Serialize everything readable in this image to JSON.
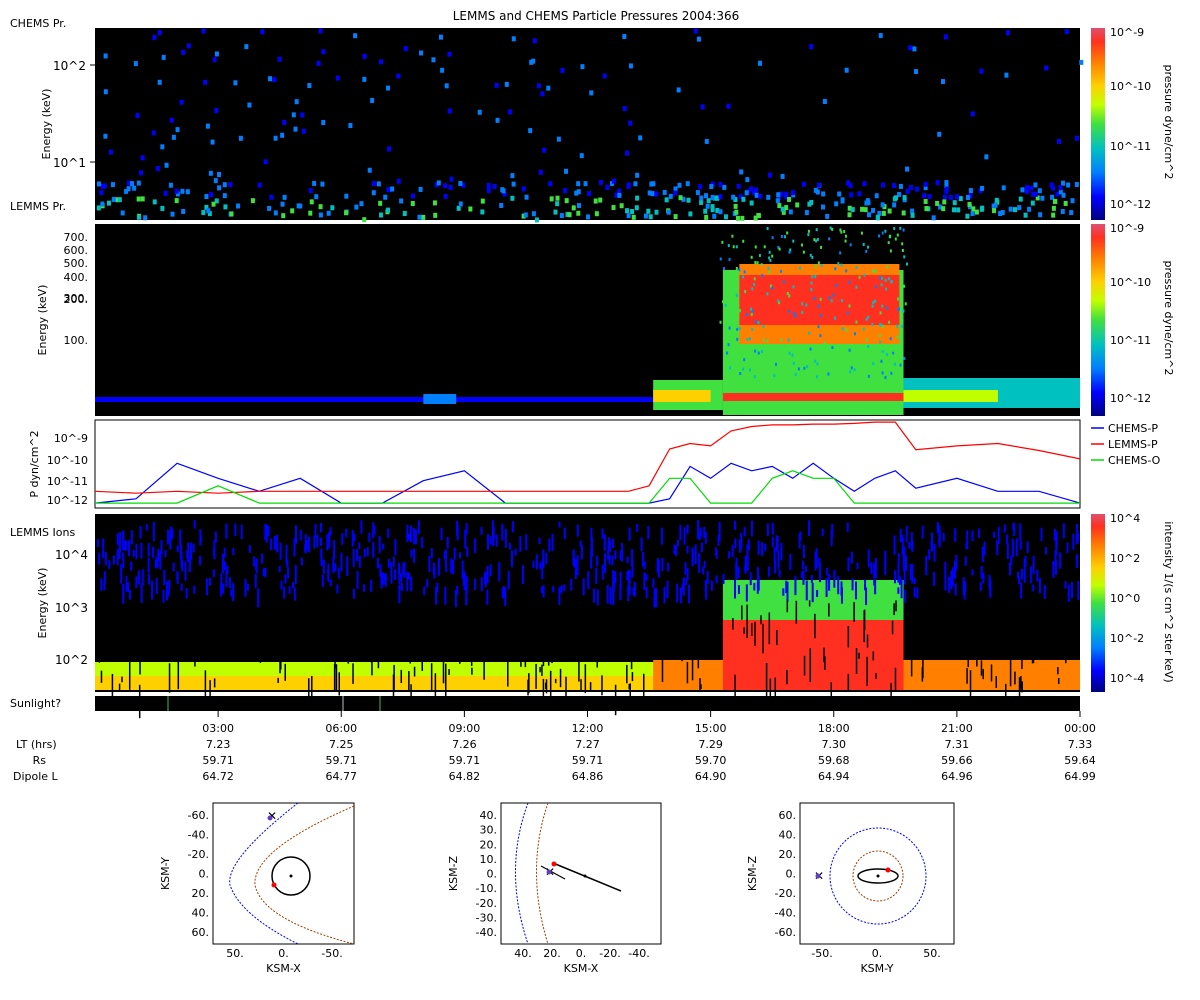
{
  "title": "LEMMS and CHEMS Particle Pressures  2004:366",
  "colors": {
    "chems_p": "#0000ff",
    "lemms_p": "#ff0000",
    "chems_o": "#00dd00",
    "panel_bg": "#000000",
    "colormap": [
      "#000080",
      "#0000ff",
      "#0080ff",
      "#00c0c0",
      "#40e040",
      "#c0ff00",
      "#ffd000",
      "#ff8000",
      "#ff3020",
      "#e05070"
    ]
  },
  "panels": {
    "chems": {
      "label": "CHEMS Pr.",
      "ylabel": "Energy (keV)",
      "yticks": [
        "10^2",
        "10^1"
      ],
      "colorbar": {
        "label": "pressure dyne/cm^2",
        "ticks": [
          "10^-9",
          "10^-10",
          "10^-11",
          "10^-12"
        ]
      }
    },
    "lemms": {
      "label": "LEMMS Pr.",
      "ylabel": "Energy (keV)",
      "yticks": [
        "700.",
        "600.",
        "500.",
        "400.",
        "300.",
        "200.",
        "100."
      ],
      "colorbar": {
        "label": "pressure dyne/cm^2",
        "ticks": [
          "10^-9",
          "10^-10",
          "10^-11",
          "10^-12"
        ]
      }
    },
    "pressure": {
      "ylabel": "P dyn/cm^2",
      "yticks": [
        "10^-9",
        "10^-10",
        "10^-11",
        "10^-12"
      ],
      "legend": [
        "CHEMS-P",
        "LEMMS-P",
        "CHEMS-O"
      ]
    },
    "ions": {
      "label": "LEMMS Ions",
      "ylabel": "Energy (keV)",
      "yticks": [
        "10^4",
        "10^3",
        "10^2"
      ],
      "colorbar": {
        "label": "intensity 1/(s cm^2 ster keV)",
        "ticks": [
          "10^4",
          "10^2",
          "10^0",
          "10^-2",
          "10^-4"
        ]
      }
    },
    "sunlight": {
      "label": "Sunlight?"
    }
  },
  "ephemeris": {
    "row_labels": [
      "LT (hrs)",
      "Rs",
      "Dipole L"
    ],
    "times": [
      "03:00",
      "06:00",
      "09:00",
      "12:00",
      "15:00",
      "18:00",
      "21:00",
      "00:00"
    ],
    "lt": [
      "7.23",
      "7.25",
      "7.26",
      "7.27",
      "7.29",
      "7.30",
      "7.31",
      "7.33"
    ],
    "rs": [
      "59.71",
      "59.71",
      "59.71",
      "59.71",
      "59.70",
      "59.68",
      "59.66",
      "59.64"
    ],
    "dipole_l": [
      "64.72",
      "64.77",
      "64.82",
      "64.86",
      "64.90",
      "64.94",
      "64.96",
      "64.99"
    ]
  },
  "orbit_plots": [
    {
      "xlabel": "KSM-X",
      "ylabel": "KSM-Y",
      "xticks": [
        "50.",
        "0.",
        "-50."
      ],
      "yticks": [
        "-60.",
        "-40.",
        "-20.",
        "0.",
        "20.",
        "40.",
        "60."
      ]
    },
    {
      "xlabel": "KSM-X",
      "ylabel": "KSM-Z",
      "xticks": [
        "40.",
        "20.",
        "0.",
        "-20.",
        "-40."
      ],
      "yticks": [
        "40.",
        "30.",
        "20.",
        "10.",
        "0.",
        "-10.",
        "-20.",
        "-30.",
        "-40."
      ]
    },
    {
      "xlabel": "KSM-Y",
      "ylabel": "KSM-Z",
      "xticks": [
        "-50.",
        "0.",
        "50."
      ],
      "yticks": [
        "60.",
        "40.",
        "20.",
        "0.",
        "-20.",
        "-40.",
        "-60."
      ]
    }
  ],
  "chart_data": {
    "type": "line",
    "title": "LEMMS and CHEMS Particle Pressures  2004:366",
    "x_unit": "hours UT (day 2004:366)",
    "xlim": [
      0,
      24
    ],
    "ylabel": "P dyn/cm^2",
    "yscale": "log",
    "ylim": [
      7e-13,
      2e-09
    ],
    "x": [
      0,
      1,
      2,
      3,
      4,
      5,
      6,
      7,
      8,
      9,
      10,
      11,
      12,
      13,
      13.5,
      14,
      14.5,
      15,
      15.5,
      16,
      16.5,
      17,
      17.5,
      18,
      18.5,
      19,
      19.5,
      20,
      21,
      22,
      23,
      24
    ],
    "series": [
      {
        "name": "CHEMS-P",
        "values": [
          1e-12,
          1.5e-12,
          4e-11,
          1e-11,
          3e-12,
          1e-11,
          1e-12,
          1e-12,
          8e-12,
          2e-11,
          1e-12,
          1e-12,
          1e-12,
          1e-12,
          1e-12,
          1.5e-12,
          3e-11,
          1e-11,
          4e-11,
          2e-11,
          3e-11,
          1e-11,
          4e-11,
          1e-11,
          3e-12,
          1e-11,
          2e-11,
          4e-12,
          1e-11,
          3e-12,
          3e-12,
          1e-12
        ]
      },
      {
        "name": "LEMMS-P",
        "values": [
          3e-12,
          2.5e-12,
          3e-12,
          2.5e-12,
          3e-12,
          3e-12,
          3e-12,
          3e-12,
          3e-12,
          3e-12,
          3e-12,
          3e-12,
          3e-12,
          3e-12,
          5e-12,
          1.5e-10,
          2.5e-10,
          2e-10,
          8e-10,
          1.2e-09,
          1.4e-09,
          1.4e-09,
          1.5e-09,
          1.5e-09,
          1.6e-09,
          1.8e-09,
          1.8e-09,
          1.4e-10,
          2e-10,
          2.5e-10,
          1.3e-10,
          6e-11
        ]
      },
      {
        "name": "CHEMS-O",
        "values": [
          1e-12,
          1e-12,
          1e-12,
          5e-12,
          1e-12,
          1e-12,
          1e-12,
          1e-12,
          1e-12,
          1e-12,
          1e-12,
          1e-12,
          1e-12,
          1e-12,
          1e-12,
          1e-11,
          1e-11,
          1e-12,
          1e-12,
          1e-12,
          1e-11,
          2e-11,
          1e-11,
          1e-11,
          1e-12,
          1e-12,
          1e-12,
          1e-12,
          1e-12,
          1e-12,
          1e-12,
          1e-12
        ]
      }
    ]
  }
}
